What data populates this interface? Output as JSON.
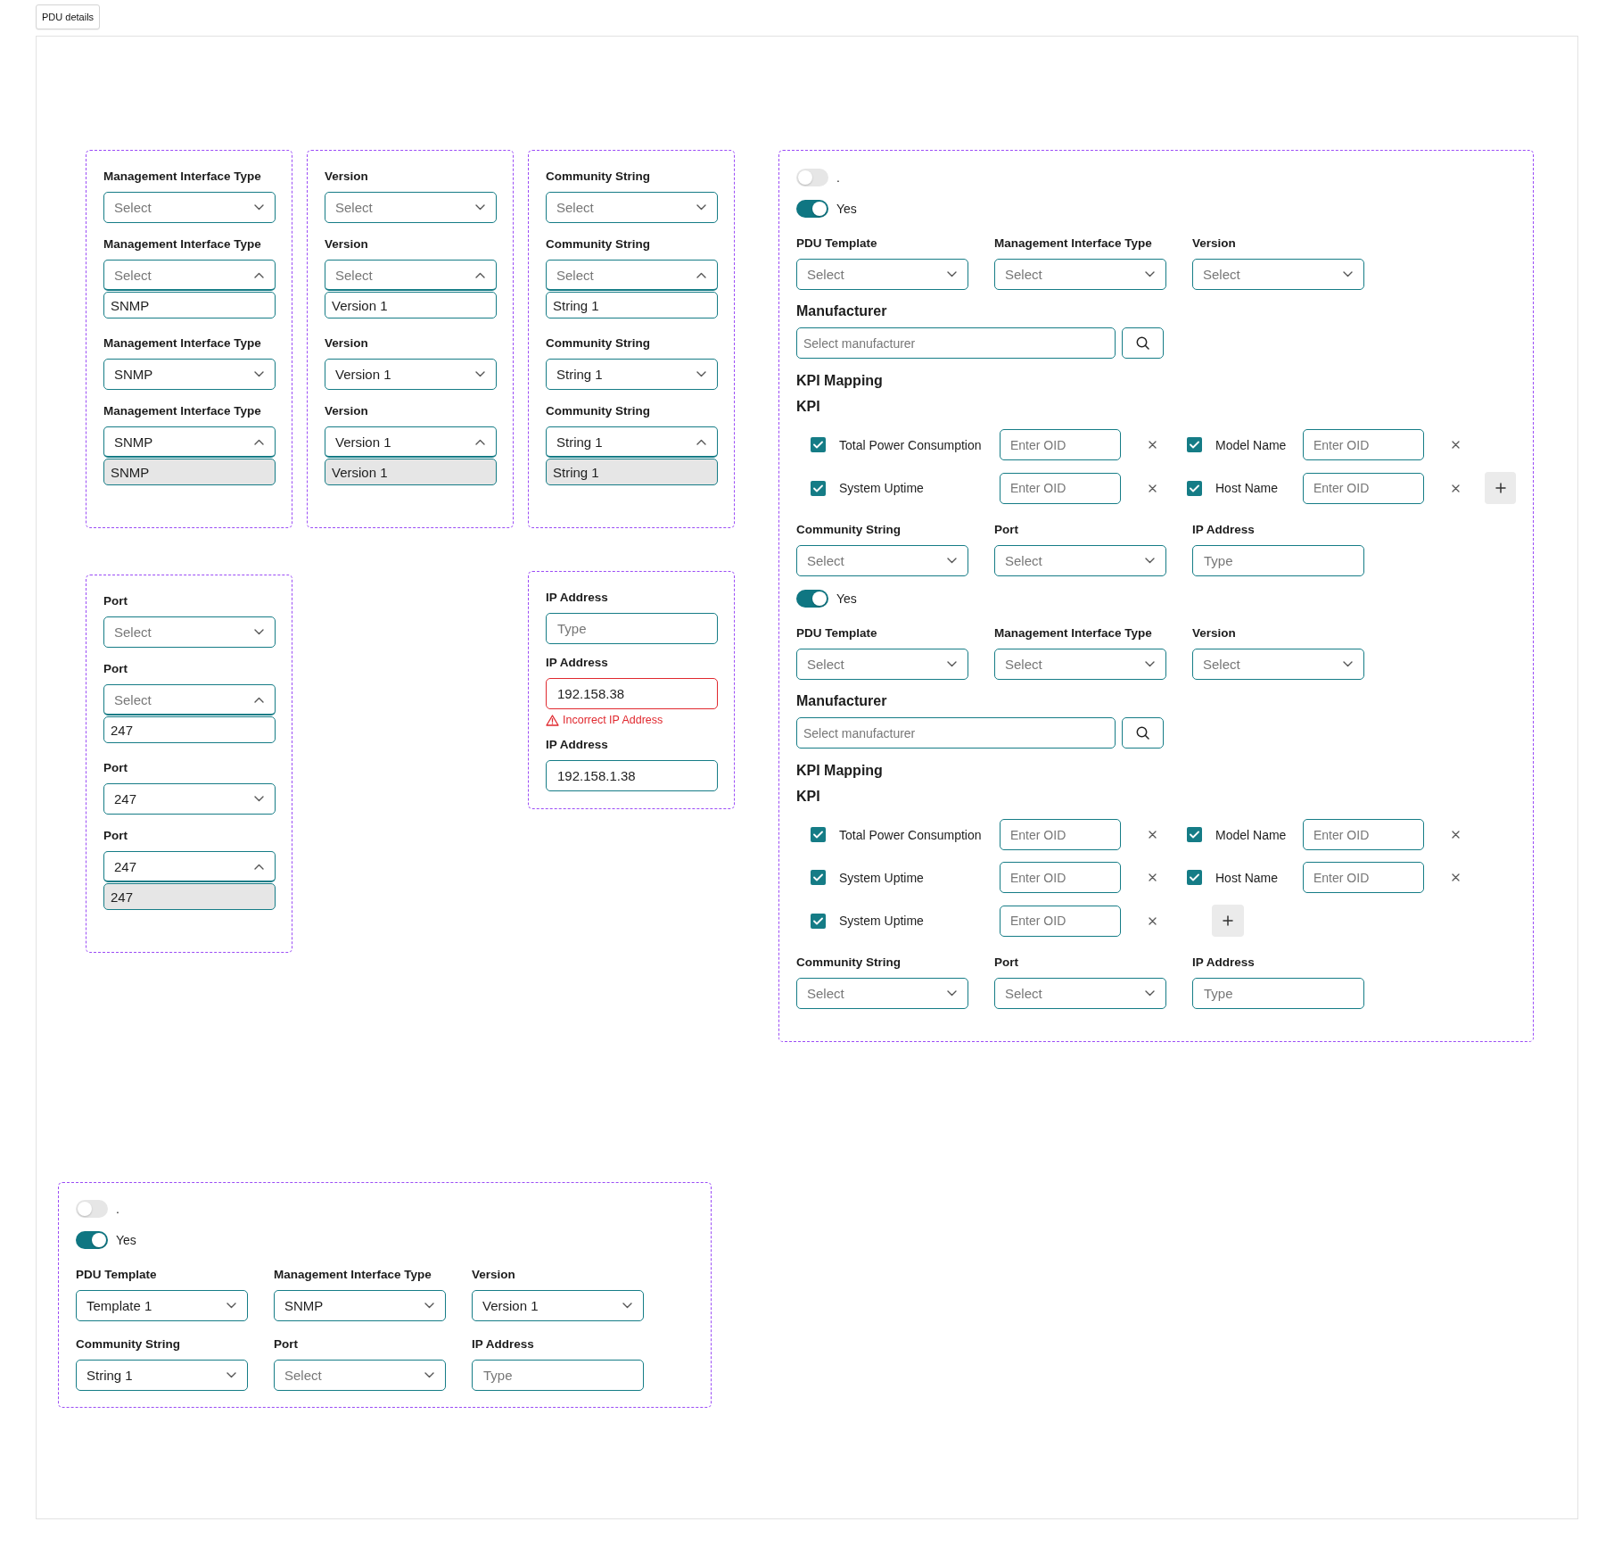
{
  "tab": {
    "label": "PDU details"
  },
  "variant_sets": [
    {
      "kind": "select",
      "items": [
        {
          "label": "Management Interface Type",
          "placeholder": "Select",
          "open": false
        },
        {
          "label": "Management Interface Type",
          "placeholder": "Select",
          "open": true,
          "options": [
            {
              "label": "SNMP",
              "selected": false
            }
          ]
        },
        {
          "label": "Management Interface Type",
          "value": "SNMP",
          "open": false
        },
        {
          "label": "Management Interface Type",
          "value": "SNMP",
          "open": true,
          "options": [
            {
              "label": "SNMP",
              "selected": true
            }
          ]
        }
      ]
    },
    {
      "kind": "select",
      "items": [
        {
          "label": "Version",
          "placeholder": "Select",
          "open": false
        },
        {
          "label": "Version",
          "placeholder": "Select",
          "open": true,
          "options": [
            {
              "label": "Version 1",
              "selected": false
            }
          ]
        },
        {
          "label": "Version",
          "value": "Version 1",
          "open": false
        },
        {
          "label": "Version",
          "value": "Version 1",
          "open": true,
          "options": [
            {
              "label": "Version 1",
              "selected": true
            }
          ]
        }
      ]
    },
    {
      "kind": "select",
      "items": [
        {
          "label": "Community String",
          "placeholder": "Select",
          "open": false
        },
        {
          "label": "Community String",
          "placeholder": "Select",
          "open": true,
          "options": [
            {
              "label": "String 1",
              "selected": false
            }
          ]
        },
        {
          "label": "Community String",
          "value": "String 1",
          "open": false
        },
        {
          "label": "Community String",
          "value": "String 1",
          "open": true,
          "options": [
            {
              "label": "String 1",
              "selected": true
            }
          ]
        }
      ]
    },
    {
      "kind": "select",
      "items": [
        {
          "label": "Port",
          "placeholder": "Select",
          "open": false
        },
        {
          "label": "Port",
          "placeholder": "Select",
          "open": true,
          "options": [
            {
              "label": "247",
              "selected": false
            }
          ]
        },
        {
          "label": "Port",
          "value": "247",
          "open": false
        },
        {
          "label": "Port",
          "value": "247",
          "open": true,
          "options": [
            {
              "label": "247",
              "selected": true
            }
          ]
        }
      ]
    },
    {
      "kind": "input",
      "items": [
        {
          "label": "IP Address",
          "placeholder": "Type",
          "invalid": false
        },
        {
          "label": "IP Address",
          "value": "192.158.38",
          "invalid": true,
          "error": "Incorrect IP Address"
        },
        {
          "label": "IP Address",
          "value": "192.158.1.38",
          "invalid": false
        }
      ]
    }
  ],
  "panels": [
    {
      "blocks": [
        {
          "kind": "toggle",
          "label": ".",
          "on": false
        },
        {
          "kind": "toggle",
          "label": "Yes",
          "on": true
        },
        {
          "kind": "form",
          "top_fields": [
            {
              "kind": "select",
              "label": "PDU Template",
              "placeholder": "Select"
            },
            {
              "kind": "select",
              "label": "Management Interface Type",
              "placeholder": "Select"
            },
            {
              "kind": "select",
              "label": "Version",
              "placeholder": "Select"
            }
          ],
          "manufacturer": {
            "label": "Manufacturer",
            "placeholder": "Select manufacturer"
          },
          "kpi_mapping": {
            "title": "KPI Mapping",
            "subtitle": "KPI",
            "kpis": [
              {
                "label": "Total Power Consumption",
                "checked": true,
                "placeholder": "Enter OID"
              },
              {
                "label": "Model Name",
                "checked": true,
                "placeholder": "Enter OID"
              },
              {
                "label": "System Uptime",
                "checked": true,
                "placeholder": "Enter OID"
              },
              {
                "label": "Host Name",
                "checked": true,
                "placeholder": "Enter OID"
              }
            ]
          },
          "bottom_fields": [
            {
              "kind": "select",
              "label": "Community String",
              "placeholder": "Select"
            },
            {
              "kind": "select",
              "label": "Port",
              "placeholder": "Select"
            },
            {
              "kind": "input",
              "label": "IP Address",
              "placeholder": "Type"
            }
          ]
        },
        {
          "kind": "toggle",
          "label": "Yes",
          "on": true
        },
        {
          "kind": "form",
          "top_fields": [
            {
              "kind": "select",
              "label": "PDU Template",
              "placeholder": "Select"
            },
            {
              "kind": "select",
              "label": "Management Interface Type",
              "placeholder": "Select"
            },
            {
              "kind": "select",
              "label": "Version",
              "placeholder": "Select"
            }
          ],
          "manufacturer": {
            "label": "Manufacturer",
            "placeholder": "Select manufacturer"
          },
          "kpi_mapping": {
            "title": "KPI Mapping",
            "subtitle": "KPI",
            "kpis": [
              {
                "label": "Total Power Consumption",
                "checked": true,
                "placeholder": "Enter OID"
              },
              {
                "label": "Model Name",
                "checked": true,
                "placeholder": "Enter OID"
              },
              {
                "label": "System Uptime",
                "checked": true,
                "placeholder": "Enter OID"
              },
              {
                "label": "Host Name",
                "checked": true,
                "placeholder": "Enter OID"
              },
              {
                "label": "System Uptime",
                "checked": true,
                "placeholder": "Enter OID"
              }
            ]
          },
          "bottom_fields": [
            {
              "kind": "select",
              "label": "Community String",
              "placeholder": "Select"
            },
            {
              "kind": "select",
              "label": "Port",
              "placeholder": "Select"
            },
            {
              "kind": "input",
              "label": "IP Address",
              "placeholder": "Type"
            }
          ]
        }
      ]
    },
    {
      "blocks": [
        {
          "kind": "toggle",
          "label": ".",
          "on": false
        },
        {
          "kind": "toggle",
          "label": "Yes",
          "on": true
        },
        {
          "kind": "form",
          "top_fields": [
            {
              "kind": "select",
              "label": "PDU Template",
              "value": "Template 1"
            },
            {
              "kind": "select",
              "label": "Management Interface Type",
              "value": "SNMP"
            },
            {
              "kind": "select",
              "label": "Version",
              "value": "Version 1"
            }
          ],
          "bottom_fields": [
            {
              "kind": "select",
              "label": "Community String",
              "value": "String 1"
            },
            {
              "kind": "select",
              "label": "Port",
              "placeholder": "Select"
            },
            {
              "kind": "input",
              "label": "IP Address",
              "placeholder": "Type"
            }
          ]
        }
      ]
    }
  ]
}
